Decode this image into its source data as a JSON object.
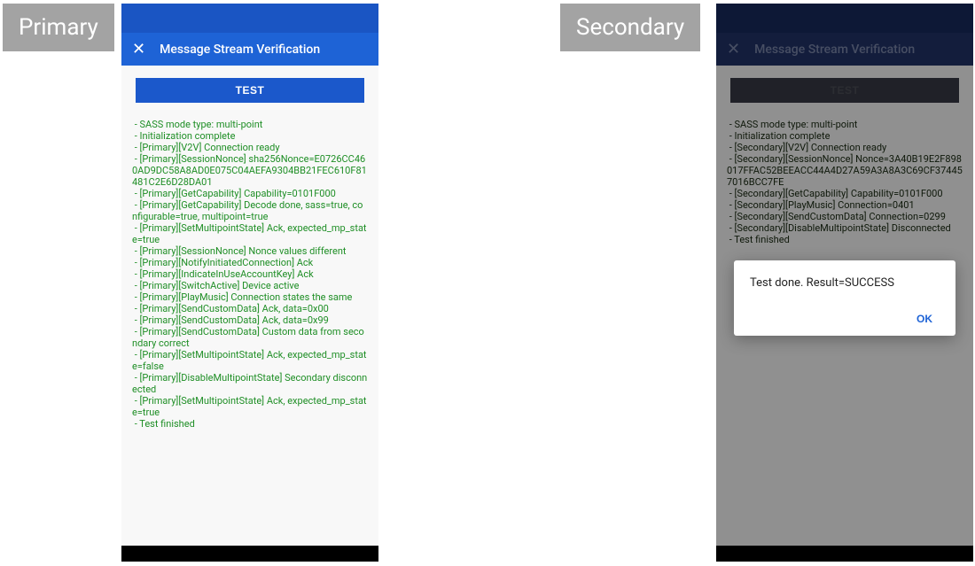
{
  "labels": {
    "primary": "Primary",
    "secondary": "Secondary"
  },
  "appbar": {
    "close_glyph": "✕",
    "title": "Message Stream Verification"
  },
  "buttons": {
    "test": "TEST"
  },
  "dialog": {
    "text": "Test done. Result=SUCCESS",
    "ok": "OK"
  },
  "logs": {
    "primary": " - SASS mode type: multi-point\n - Initialization complete\n - [Primary][V2V] Connection ready\n - [Primary][SessionNonce] sha256Nonce=E0726CC460AD9DC58A8AD0E075C04AEFA9304BB21FEC610F81481C2E6D28DA01\n - [Primary][GetCapability] Capability=0101F000\n - [Primary][GetCapability] Decode done, sass=true, configurable=true, multipoint=true\n - [Primary][SetMultipointState] Ack, expected_mp_state=true\n - [Primary][SessionNonce] Nonce values different\n - [Primary][NotifyInitiatedConnection] Ack\n - [Primary][IndicateInUseAccountKey] Ack\n - [Primary][SwitchActive] Device active\n - [Primary][PlayMusic] Connection states the same\n - [Primary][SendCustomData] Ack, data=0x00\n - [Primary][SendCustomData] Ack, data=0x99\n - [Primary][SendCustomData] Custom data from secondary correct\n - [Primary][SetMultipointState] Ack, expected_mp_state=false\n - [Primary][DisableMultipointState] Secondary disconnected\n - [Primary][SetMultipointState] Ack, expected_mp_state=true\n - Test finished",
    "secondary": " - SASS mode type: multi-point\n - Initialization complete\n - [Secondary][V2V] Connection ready\n - [Secondary][SessionNonce] Nonce=3A40B19E2F898017FFAC52BEEACC44A4D27A59A3A8A3C69CF374457016BCC7FE\n - [Secondary][GetCapability] Capability=0101F000\n - [Secondary][PlayMusic] Connection=0401\n - [Secondary][SendCustomData] Connection=0299\n - [Secondary][DisableMultipointState] Disconnected\n - Test finished"
  }
}
